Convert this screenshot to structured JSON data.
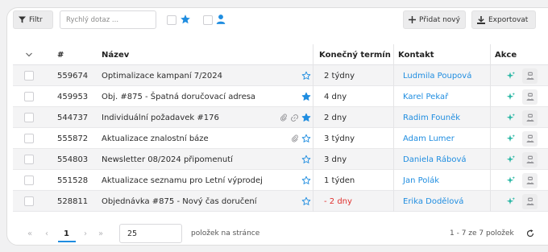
{
  "toolbar": {
    "filter_label": "Filtr",
    "search_placeholder": "Rychlý dotaz ...",
    "add_label": "Přidat nový",
    "export_label": "Exportovat"
  },
  "table": {
    "headers": {
      "id": "#",
      "name": "Název",
      "deadline": "Konečný termín",
      "contact": "Kontakt",
      "actions": "Akce"
    },
    "rows": [
      {
        "id": "559674",
        "name": "Optimalizace kampaní 7/2024",
        "attach": false,
        "link": false,
        "starred": false,
        "deadline": "2 týdny",
        "overdue": false,
        "contact": "Ludmila Poupová"
      },
      {
        "id": "459953",
        "name": "Obj. #875 - Špatná doručovací adresa",
        "attach": false,
        "link": false,
        "starred": true,
        "deadline": "4 dny",
        "overdue": false,
        "contact": "Karel Pekař"
      },
      {
        "id": "544737",
        "name": "Individuální požadavek #176",
        "attach": true,
        "link": true,
        "starred": true,
        "deadline": "2 dny",
        "overdue": false,
        "contact": "Radim Founěk"
      },
      {
        "id": "555872",
        "name": "Aktualizace znalostní báze",
        "attach": true,
        "link": false,
        "starred": false,
        "deadline": "3 týdny",
        "overdue": false,
        "contact": "Adam Lumer"
      },
      {
        "id": "554803",
        "name": "Newsletter 08/2024 připomenutí",
        "attach": false,
        "link": false,
        "starred": false,
        "deadline": "3 dny",
        "overdue": false,
        "contact": "Daniela Rábová"
      },
      {
        "id": "551528",
        "name": "Aktualizace seznamu pro Letní výprodej",
        "attach": false,
        "link": false,
        "starred": false,
        "deadline": "1 týden",
        "overdue": false,
        "contact": "Jan Polák"
      },
      {
        "id": "528811",
        "name": "Objednávka #875 - Nový čas doručení",
        "attach": false,
        "link": false,
        "starred": false,
        "deadline": "- 2 dny",
        "overdue": true,
        "contact": "Erika Dodělová"
      }
    ]
  },
  "pager": {
    "first": "«",
    "prev": "‹",
    "current_page": "1",
    "next": "›",
    "last": "»",
    "page_size": "25",
    "page_size_label": "položek na stránce",
    "range_label": "1 - 7 ze 7 položek"
  },
  "colors": {
    "accent": "#1f8de0",
    "overdue": "#e0312e",
    "ai_icon": "#2bb7a5",
    "star": "#1f8de0"
  },
  "icons": {
    "filter": "funnel-icon",
    "star": "star-icon",
    "user": "person-icon",
    "add": "plus-icon",
    "export": "download-icon",
    "ai": "sparkle-icon",
    "assign": "agent-icon",
    "attach": "paperclip-icon",
    "link": "link-icon",
    "sort": "chevron-down-icon",
    "refresh": "refresh-icon"
  }
}
